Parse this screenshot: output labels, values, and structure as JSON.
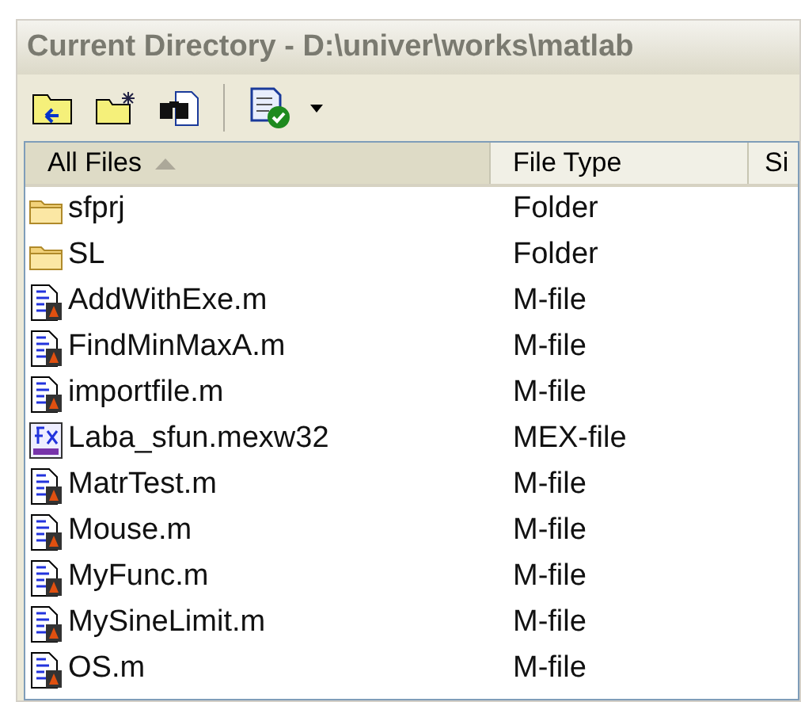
{
  "window": {
    "title": "Current Directory - D:\\univer\\works\\matlab"
  },
  "table": {
    "columns": [
      {
        "label": "All Files",
        "sorted": true
      },
      {
        "label": "File Type",
        "sorted": false
      },
      {
        "label": "Si",
        "sorted": false
      }
    ],
    "rows": [
      {
        "kind": "folder",
        "name": "sfprj",
        "type": "Folder"
      },
      {
        "kind": "folder",
        "name": "SL",
        "type": "Folder"
      },
      {
        "kind": "mfile",
        "name": "AddWithExe.m",
        "type": "M-file"
      },
      {
        "kind": "mfile",
        "name": "FindMinMaxA.m",
        "type": "M-file"
      },
      {
        "kind": "mfile",
        "name": "importfile.m",
        "type": "M-file"
      },
      {
        "kind": "mex",
        "name": "Laba_sfun.mexw32",
        "type": "MEX-file"
      },
      {
        "kind": "mfile",
        "name": "MatrTest.m",
        "type": "M-file"
      },
      {
        "kind": "mfile",
        "name": "Mouse.m",
        "type": "M-file"
      },
      {
        "kind": "mfile",
        "name": "MyFunc.m",
        "type": "M-file"
      },
      {
        "kind": "mfile",
        "name": "MySineLimit.m",
        "type": "M-file"
      },
      {
        "kind": "mfile",
        "name": "OS.m",
        "type": "M-file"
      }
    ]
  }
}
